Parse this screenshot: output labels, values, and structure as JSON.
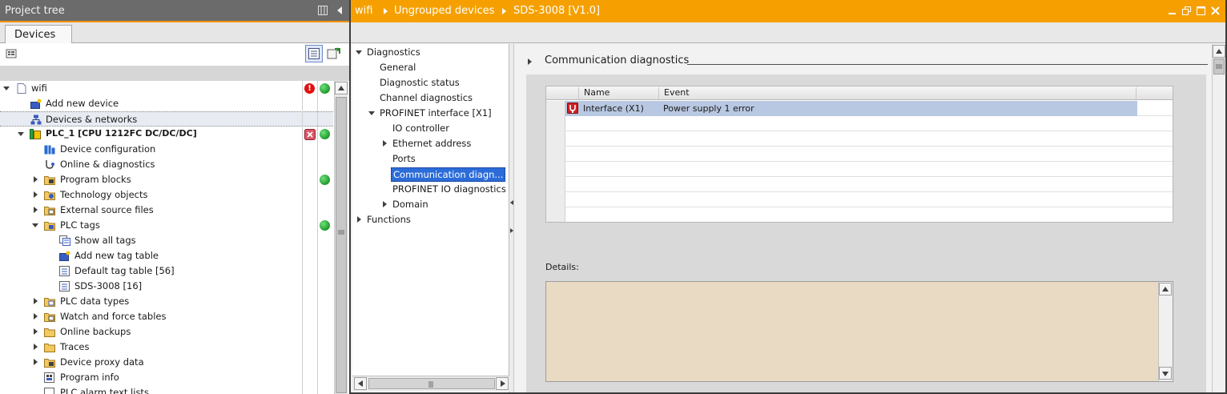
{
  "project_tree": {
    "title": "Project tree",
    "tab": "Devices",
    "items": [
      {
        "label": "wifi",
        "icon": "project-file-icon",
        "expanded": true,
        "status": [
          "error-icon",
          "online-ok-icon"
        ]
      },
      {
        "label": "Add new device",
        "icon": "add-device-icon"
      },
      {
        "label": "Devices & networks",
        "icon": "devices-networks-icon"
      },
      {
        "label": "PLC_1 [CPU 1212FC DC/DC/DC]",
        "icon": "plc-icon",
        "expanded": true,
        "status": [
          "device-fault-icon",
          "online-ok-icon"
        ]
      },
      {
        "label": "Device configuration",
        "icon": "device-configuration-icon"
      },
      {
        "label": "Online & diagnostics",
        "icon": "online-diagnostics-icon"
      },
      {
        "label": "Program blocks",
        "icon": "folder-icon",
        "status": [
          "online-ok-icon"
        ]
      },
      {
        "label": "Technology objects",
        "icon": "folder-icon"
      },
      {
        "label": "External source files",
        "icon": "folder-icon"
      },
      {
        "label": "PLC tags",
        "icon": "folder-icon",
        "expanded": true,
        "status": [
          "online-ok-icon"
        ]
      },
      {
        "label": "Show all tags",
        "icon": "tag-table-icon"
      },
      {
        "label": "Add new tag table",
        "icon": "add-tag-table-icon"
      },
      {
        "label": "Default tag table [56]",
        "icon": "tag-table-icon"
      },
      {
        "label": "SDS-3008 [16]",
        "icon": "tag-table-icon"
      },
      {
        "label": "PLC data types",
        "icon": "folder-icon"
      },
      {
        "label": "Watch and force tables",
        "icon": "folder-icon"
      },
      {
        "label": "Online backups",
        "icon": "folder-icon"
      },
      {
        "label": "Traces",
        "icon": "folder-icon"
      },
      {
        "label": "Device proxy data",
        "icon": "folder-icon"
      },
      {
        "label": "Program info",
        "icon": "program-info-icon"
      },
      {
        "label": "PLC alarm text lists",
        "icon": "alarm-text-icon"
      }
    ]
  },
  "editor": {
    "breadcrumb": [
      "wifi",
      "Ungrouped devices",
      "SDS-3008 [V1.0]"
    ],
    "nav": [
      {
        "label": "Diagnostics",
        "expanded": true
      },
      {
        "label": "General"
      },
      {
        "label": "Diagnostic status"
      },
      {
        "label": "Channel diagnostics"
      },
      {
        "label": "PROFINET interface [X1]",
        "expanded": true
      },
      {
        "label": "IO controller"
      },
      {
        "label": "Ethernet address"
      },
      {
        "label": "Ports"
      },
      {
        "label": "Communication diagn...",
        "selected": true
      },
      {
        "label": "PROFINET IO diagnostics"
      },
      {
        "label": "Domain"
      },
      {
        "label": "Functions"
      }
    ],
    "section_title": "Communication diagnostics",
    "table": {
      "columns": [
        "Name",
        "Event"
      ],
      "rows": [
        {
          "icon": "fault-wrench-icon",
          "name": "Interface (X1)",
          "event": "Power supply 1 error"
        }
      ]
    },
    "details_label": "Details:",
    "details_text": ""
  },
  "colors": {
    "title_bar": "#6b6b6b",
    "editor_title_bar": "#f5a000",
    "accent_orange": "#f29400",
    "selection_blue": "#2b6cd8",
    "row_selection": "#b9c8e2",
    "details_background": "#e9dac4",
    "status_ok": "#1f9a2c",
    "status_error": "#e01010"
  }
}
